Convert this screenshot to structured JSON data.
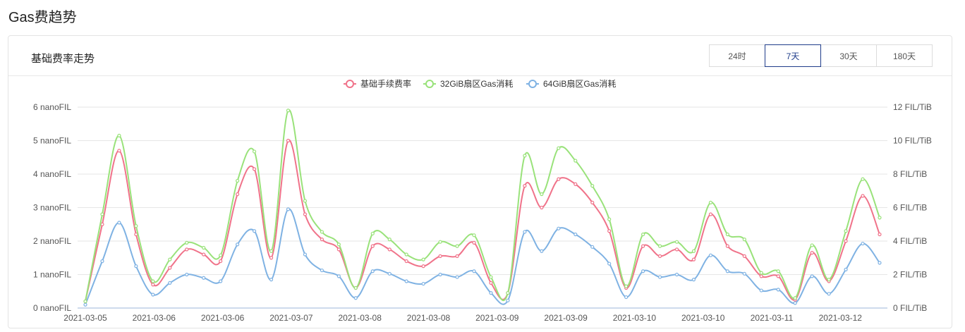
{
  "page": {
    "title": "Gas费趋势"
  },
  "card": {
    "title": "基础费率走势",
    "tabs": [
      {
        "label": "24时",
        "active": false
      },
      {
        "label": "7天",
        "active": true
      },
      {
        "label": "30天",
        "active": false
      },
      {
        "label": "180天",
        "active": false
      }
    ]
  },
  "chart_data": {
    "type": "line",
    "x_tick_labels": [
      "2021-03-05",
      "2021-03-06",
      "2021-03-06",
      "2021-03-07",
      "2021-03-08",
      "2021-03-08",
      "2021-03-09",
      "2021-03-09",
      "2021-03-10",
      "2021-03-10",
      "2021-03-11",
      "2021-03-12"
    ],
    "y_left": {
      "ticks": [
        "0 nanoFIL",
        "1 nanoFIL",
        "2 nanoFIL",
        "3 nanoFIL",
        "4 nanoFIL",
        "5 nanoFIL",
        "6 nanoFIL"
      ],
      "range": [
        0,
        6
      ]
    },
    "y_right": {
      "ticks": [
        "0 FIL/TiB",
        "2 FIL/TiB",
        "4 FIL/TiB",
        "6 FIL/TiB",
        "8 FIL/TiB",
        "10 FIL/TiB",
        "12 FIL/TiB"
      ],
      "range": [
        0,
        12
      ]
    },
    "grid": true,
    "legend_position": "top-center",
    "series": [
      {
        "name": "基础手续费率",
        "color": "#f0738a",
        "axis": "left",
        "values": [
          0.2,
          2.5,
          4.7,
          2.2,
          0.7,
          1.2,
          1.75,
          1.6,
          1.4,
          3.4,
          4.15,
          1.5,
          5.0,
          2.8,
          2.05,
          1.75,
          0.6,
          1.85,
          1.75,
          1.4,
          1.25,
          1.55,
          1.55,
          1.95,
          0.75,
          0.45,
          3.65,
          3.0,
          3.85,
          3.7,
          3.15,
          2.3,
          0.6,
          1.85,
          1.55,
          1.75,
          1.45,
          2.8,
          1.85,
          1.55,
          0.95,
          0.95,
          0.25,
          1.65,
          0.8,
          2.0,
          3.35,
          2.2
        ]
      },
      {
        "name": "32GiB扇区Gas消耗",
        "color": "#99e27a",
        "axis": "right",
        "values": [
          0.4,
          5.6,
          10.3,
          4.9,
          1.6,
          2.9,
          3.9,
          3.6,
          3.15,
          7.6,
          9.35,
          3.4,
          11.8,
          6.4,
          4.55,
          3.8,
          1.2,
          4.45,
          4.1,
          3.2,
          2.9,
          3.95,
          3.7,
          4.35,
          1.85,
          0.9,
          9.1,
          6.8,
          9.55,
          8.8,
          7.3,
          5.3,
          1.3,
          4.4,
          3.7,
          3.95,
          3.4,
          6.3,
          4.4,
          4.1,
          2.1,
          2.2,
          0.6,
          3.75,
          1.7,
          4.6,
          7.7,
          5.4
        ]
      },
      {
        "name": "64GiB扇区Gas消耗",
        "color": "#7fb2e3",
        "axis": "right",
        "values": [
          0.2,
          2.8,
          5.1,
          2.5,
          0.8,
          1.5,
          2.0,
          1.8,
          1.6,
          3.8,
          4.6,
          1.7,
          5.9,
          3.2,
          2.25,
          1.9,
          0.6,
          2.2,
          2.05,
          1.6,
          1.45,
          2.0,
          1.85,
          2.2,
          0.9,
          0.45,
          4.55,
          3.4,
          4.75,
          4.4,
          3.65,
          2.65,
          0.65,
          2.2,
          1.85,
          2.0,
          1.7,
          3.15,
          2.2,
          2.05,
          1.05,
          1.1,
          0.3,
          1.9,
          0.85,
          2.3,
          3.85,
          2.7
        ]
      }
    ]
  }
}
